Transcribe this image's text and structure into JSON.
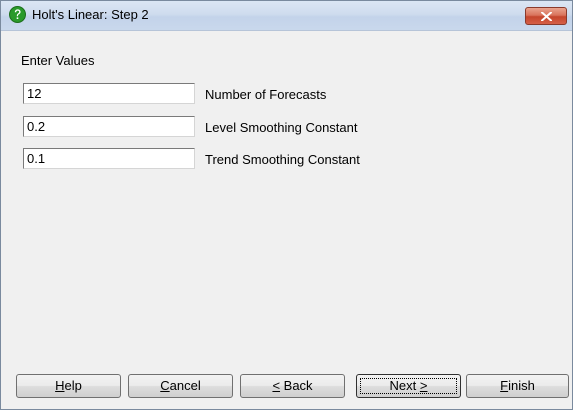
{
  "window": {
    "title": "Holt's Linear: Step 2",
    "icon": "help-question-icon",
    "close_icon": "close-x-icon",
    "accent_icon_color": "#2a9a2a",
    "close_button_color": "#c5452c"
  },
  "section": {
    "label": "Enter Values"
  },
  "fields": [
    {
      "value": "12",
      "label": "Number of Forecasts"
    },
    {
      "value": "0.2",
      "label": "Level Smoothing Constant"
    },
    {
      "value": "0.1",
      "label": "Trend Smoothing Constant"
    }
  ],
  "buttons": {
    "help": {
      "mnemonic": "H",
      "rest": "elp"
    },
    "cancel": {
      "mnemonic": "C",
      "rest": "ancel"
    },
    "back": {
      "mnemonic": "<",
      "rest": " Back"
    },
    "next": {
      "prefix": "Next ",
      "mnemonic": ">"
    },
    "finish": {
      "mnemonic": "F",
      "rest": "inish"
    }
  }
}
